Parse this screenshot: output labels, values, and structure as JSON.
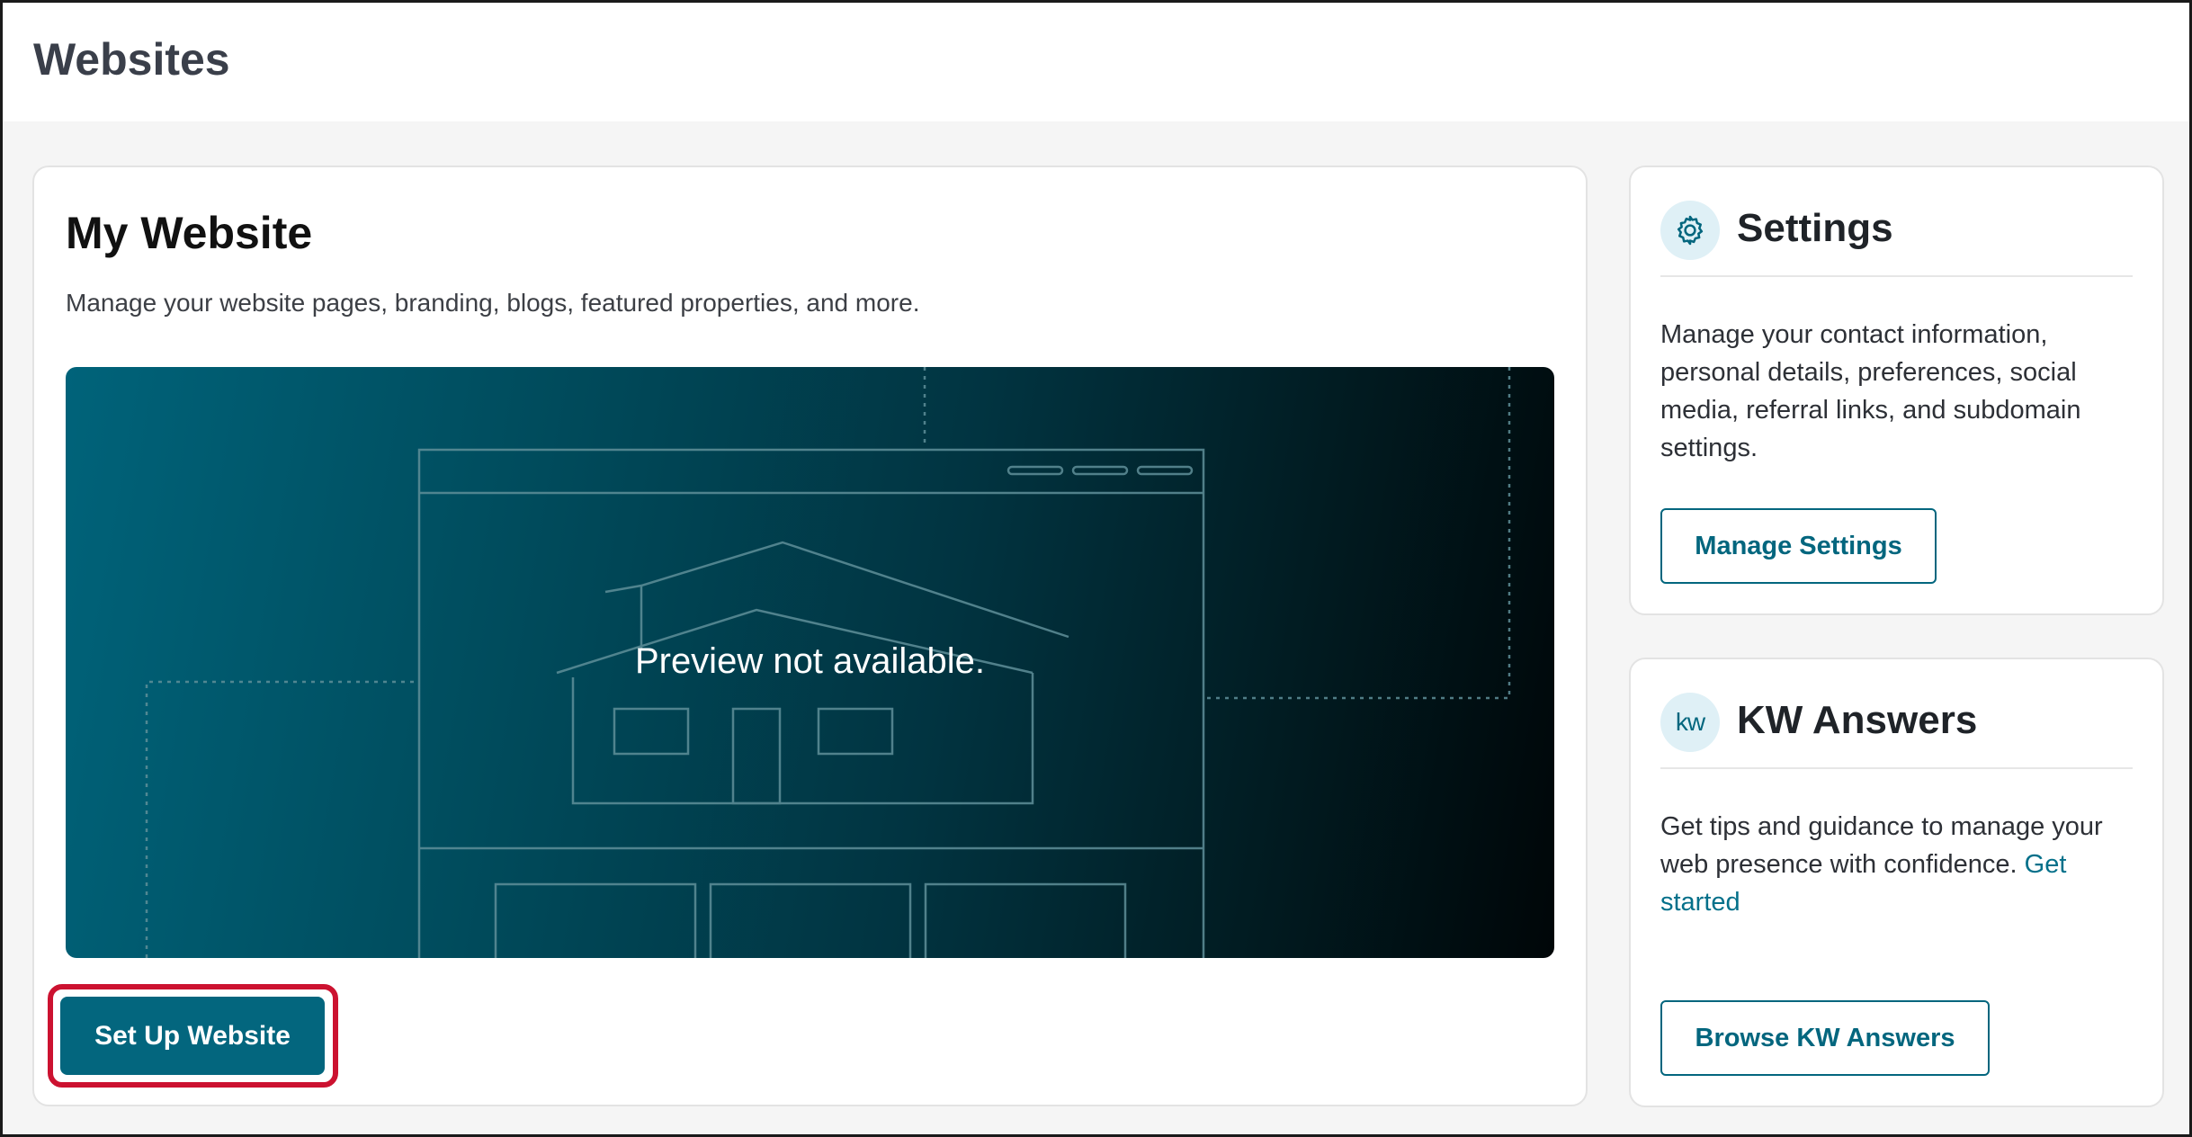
{
  "page": {
    "title": "Websites"
  },
  "my_website": {
    "title": "My Website",
    "description": "Manage your website pages, branding, blogs, featured properties, and more.",
    "preview_text": "Preview not available.",
    "setup_button_label": "Set Up Website"
  },
  "settings": {
    "icon": "gear-icon",
    "title": "Settings",
    "description": "Manage your contact information, personal details, preferences, social media, referral links, and subdomain settings.",
    "button_label": "Manage Settings"
  },
  "kw_answers": {
    "icon": "kw-logo-icon",
    "icon_text": "kw",
    "title": "KW Answers",
    "description": "Get tips and guidance to manage your web presence with confidence.",
    "link_text": "Get started",
    "button_label": "Browse KW Answers"
  },
  "colors": {
    "primary": "#03667e",
    "highlight": "#cc1230",
    "icon_bg": "#dff0f6"
  }
}
